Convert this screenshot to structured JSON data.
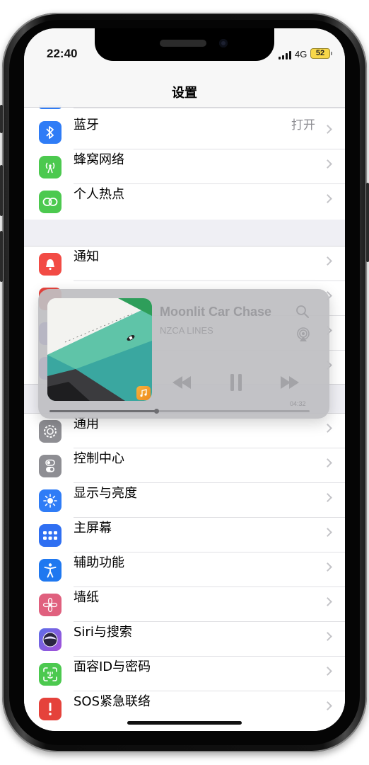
{
  "status_bar": {
    "time": "22:40",
    "network": "4G",
    "battery": "52"
  },
  "header": {
    "title": "设置"
  },
  "group1": [
    {
      "label": "蓝牙",
      "value": "打开",
      "icon": "bluetooth-icon",
      "color": "#2f7cf6"
    },
    {
      "label": "蜂窝网络",
      "value": "",
      "icon": "antenna-icon",
      "color": "#4cc94f"
    },
    {
      "label": "个人热点",
      "value": "",
      "icon": "chain-link-icon",
      "color": "#4cc94f"
    }
  ],
  "group2": [
    {
      "label": "通知",
      "icon": "notification-bell-icon",
      "color": "#f24b45"
    }
  ],
  "group3": [
    {
      "label": "通用",
      "icon": "gear-icon",
      "color": "#8e8e93"
    },
    {
      "label": "控制中心",
      "icon": "switches-icon",
      "color": "#8e8e93"
    },
    {
      "label": "显示与亮度",
      "icon": "sun-icon",
      "color": "#2f7cf6"
    },
    {
      "label": "主屏幕",
      "icon": "app-grid-icon",
      "color": "#2f6ff2"
    },
    {
      "label": "辅助功能",
      "icon": "accessibility-person-icon",
      "color": "#1f78f0"
    },
    {
      "label": "墙纸",
      "icon": "flower-icon",
      "color": "#e0607e"
    },
    {
      "label": "Siri与搜索",
      "icon": "siri-icon",
      "color": "#7d5bd9"
    },
    {
      "label": "面容ID与密码",
      "icon": "face-id-icon",
      "color": "#4cc94f"
    },
    {
      "label": "SOS紧急联络",
      "icon": "sos-icon",
      "color": "#e5423b"
    }
  ],
  "player": {
    "title": "Moonlit Car Chase",
    "artist": "NZCA LINES",
    "time": "04:32",
    "progress": 0.41
  }
}
